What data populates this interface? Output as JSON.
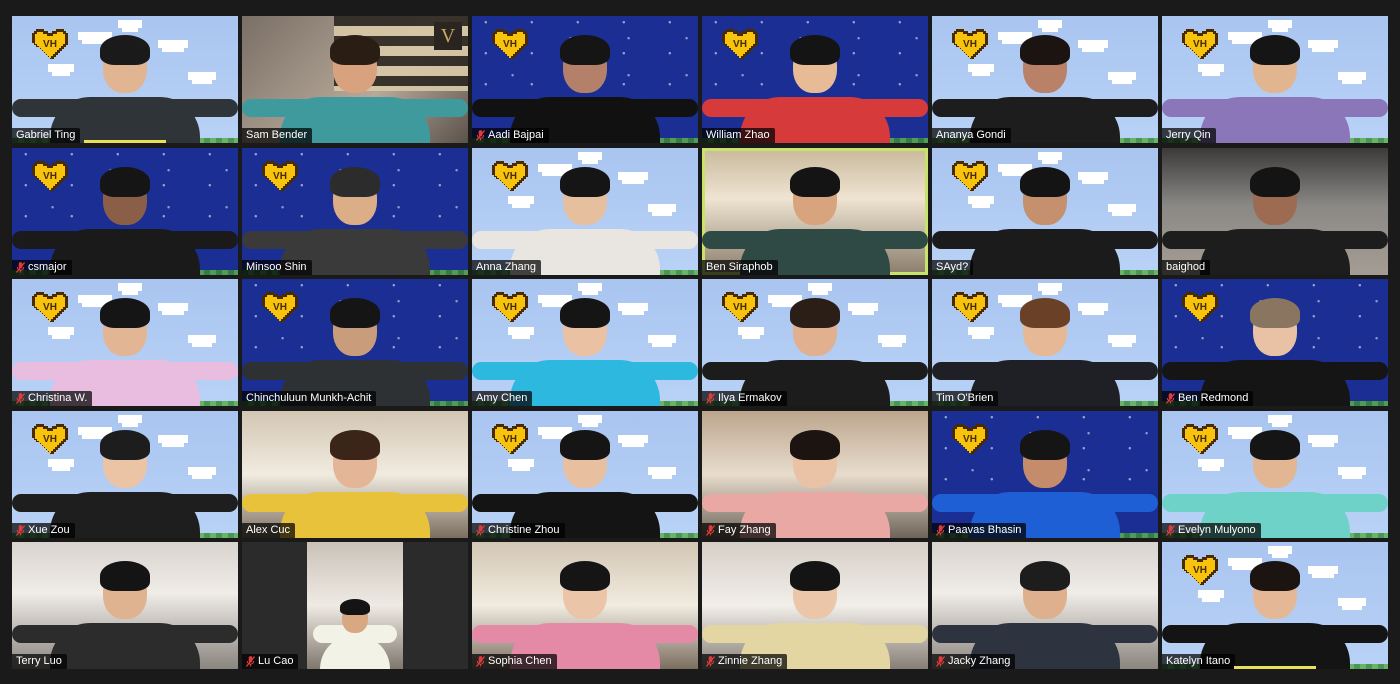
{
  "meeting": {
    "view": "gallery",
    "theme_colors": {
      "sky": "#b4cdf4",
      "night": "#1b2e93",
      "heart": "#f7c30d",
      "heart_outline": "#4a2b00",
      "speaker_border": "#c8e36a",
      "mute": "#e03b3b"
    },
    "participants": [
      {
        "name": "Gabriel Ting",
        "muted": false,
        "bg": "sky",
        "badge": true,
        "skin": "#e1b591",
        "hair": "#1a1a1a",
        "shirt": "#2e3438",
        "spotlight": true
      },
      {
        "name": "Sam Bender",
        "muted": false,
        "bg": "room-a",
        "badge": false,
        "skin": "#d9a27f",
        "hair": "#2a1d14",
        "shirt": "#3f9a9e",
        "flag": true
      },
      {
        "name": "Aadi Bajpai",
        "muted": true,
        "bg": "night",
        "badge": true,
        "skin": "#b5806a",
        "hair": "#151515",
        "shirt": "#111111"
      },
      {
        "name": "William Zhao",
        "muted": false,
        "bg": "night",
        "badge": true,
        "skin": "#e6bb95",
        "hair": "#141414",
        "shirt": "#d63a3a"
      },
      {
        "name": "Ananya Gondi",
        "muted": false,
        "bg": "sky",
        "badge": true,
        "skin": "#b98268",
        "hair": "#1b1410",
        "shirt": "#1d1d1d"
      },
      {
        "name": "Jerry Qin",
        "muted": false,
        "bg": "sky",
        "badge": true,
        "skin": "#e2b591",
        "hair": "#151515",
        "shirt": "#8a76b8"
      },
      {
        "name": "csmajor",
        "muted": true,
        "bg": "night",
        "badge": true,
        "skin": "#8b5e48",
        "hair": "#151515",
        "shirt": "#1a1a1a"
      },
      {
        "name": "Minsoo Shin",
        "muted": false,
        "bg": "night",
        "badge": true,
        "skin": "#dcae88",
        "hair": "#2c2c2c",
        "shirt": "#3a3a3a"
      },
      {
        "name": "Anna Zhang",
        "muted": false,
        "bg": "sky",
        "badge": true,
        "skin": "#e6bf9e",
        "hair": "#151515",
        "shirt": "#e9e6e2"
      },
      {
        "name": "Ben Siraphob",
        "muted": false,
        "bg": "room-b",
        "badge": false,
        "skin": "#d7a47e",
        "hair": "#141414",
        "shirt": "#2f4a44",
        "speaking": true
      },
      {
        "name": "SAyd?",
        "muted": false,
        "bg": "sky",
        "badge": true,
        "skin": "#c5906e",
        "hair": "#141414",
        "shirt": "#1b1b1b"
      },
      {
        "name": "baighod",
        "muted": false,
        "bg": "room-c",
        "badge": false,
        "skin": "#9d6a52",
        "hair": "#141414",
        "shirt": "#1d1d1d"
      },
      {
        "name": "Christina W.",
        "muted": true,
        "bg": "sky",
        "badge": true,
        "skin": "#e2b595",
        "hair": "#151515",
        "shirt": "#e8bde0"
      },
      {
        "name": "Chinchuluun Munkh-Achit",
        "muted": false,
        "bg": "night",
        "badge": true,
        "skin": "#c99d7b",
        "hair": "#151515",
        "shirt": "#2e3134"
      },
      {
        "name": "Amy Chen",
        "muted": false,
        "bg": "sky",
        "badge": true,
        "skin": "#eac2a3",
        "hair": "#151515",
        "shirt": "#2db8e0"
      },
      {
        "name": "Ilya Ermakov",
        "muted": true,
        "bg": "sky",
        "badge": true,
        "skin": "#e1b08e",
        "hair": "#2a1e16",
        "shirt": "#1c1c1c"
      },
      {
        "name": "Tim O'Brien",
        "muted": false,
        "bg": "sky",
        "badge": true,
        "skin": "#e6b896",
        "hair": "#6a4026",
        "shirt": "#1f2026"
      },
      {
        "name": "Ben Redmond",
        "muted": true,
        "bg": "night",
        "badge": true,
        "skin": "#e9c2a6",
        "hair": "#8a7560",
        "shirt": "#151515"
      },
      {
        "name": "Xue Zou",
        "muted": true,
        "bg": "sky",
        "badge": true,
        "skin": "#ebc4a5",
        "hair": "#1d1d1d",
        "shirt": "#1e1e1e"
      },
      {
        "name": "Alex Cuc",
        "muted": false,
        "bg": "room-d",
        "badge": false,
        "skin": "#e4b596",
        "hair": "#3a2518",
        "shirt": "#e8c23a"
      },
      {
        "name": "Christine Zhou",
        "muted": true,
        "bg": "sky",
        "badge": true,
        "skin": "#e8c0a0",
        "hair": "#151515",
        "shirt": "#141414"
      },
      {
        "name": "Fay Zhang",
        "muted": true,
        "bg": "room-e",
        "badge": false,
        "skin": "#eac3a6",
        "hair": "#1b1410",
        "shirt": "#e9a8a4"
      },
      {
        "name": "Paavas Bhasin",
        "muted": true,
        "bg": "night",
        "badge": true,
        "skin": "#c48c6a",
        "hair": "#151515",
        "shirt": "#1f5fd6"
      },
      {
        "name": "Evelyn Mulyono",
        "muted": true,
        "bg": "sky",
        "badge": true,
        "skin": "#e2b593",
        "hair": "#151515",
        "shirt": "#6fd2c8"
      },
      {
        "name": "Terry Luo",
        "muted": false,
        "bg": "room-f",
        "badge": false,
        "skin": "#e0b390",
        "hair": "#141414",
        "shirt": "#2c2c2c"
      },
      {
        "name": "Lu Cao",
        "muted": true,
        "bg": "dark",
        "badge": false,
        "skin": "#d8a883",
        "hair": "#141414",
        "shirt": "#f2f2e6",
        "inner": true
      },
      {
        "name": "Sophia Chen",
        "muted": true,
        "bg": "room-d",
        "badge": false,
        "skin": "#ebc5a8",
        "hair": "#151515",
        "shirt": "#e48aa6"
      },
      {
        "name": "Zinnie Zhang",
        "muted": true,
        "bg": "room-g",
        "badge": false,
        "skin": "#ecc6a8",
        "hair": "#141414",
        "shirt": "#e3d6a2"
      },
      {
        "name": "Jacky Zhang",
        "muted": true,
        "bg": "room-f",
        "badge": false,
        "skin": "#dfb08d",
        "hair": "#1d1d1d",
        "shirt": "#2e3340"
      },
      {
        "name": "Katelyn Itano",
        "muted": false,
        "bg": "sky",
        "badge": true,
        "skin": "#e4b896",
        "hair": "#1b1410",
        "shirt": "#141414",
        "spotlight": true
      }
    ]
  }
}
